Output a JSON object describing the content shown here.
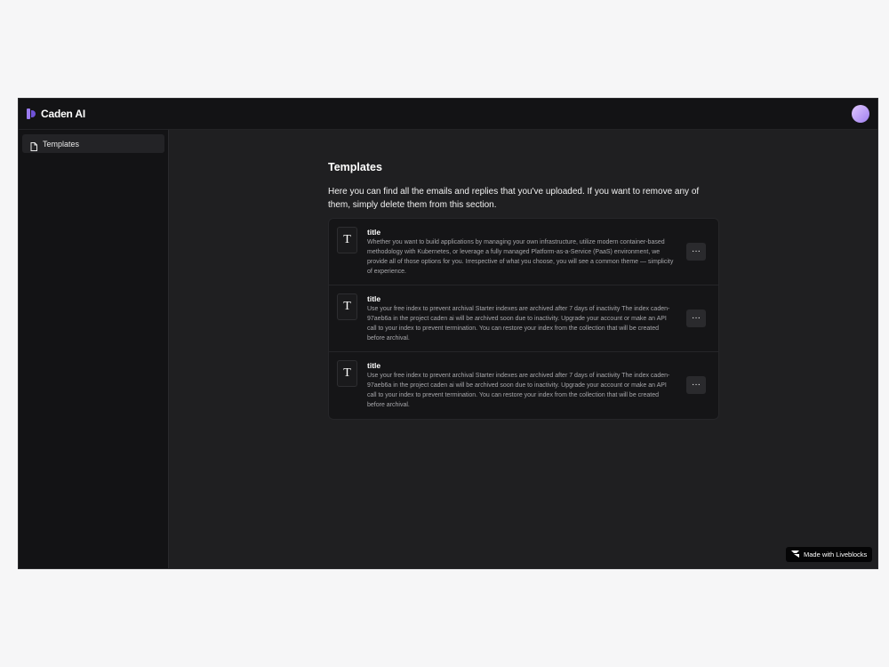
{
  "header": {
    "app_name": "Caden AI",
    "accent": "#9b7cf0"
  },
  "sidebar": {
    "items": [
      {
        "label": "Templates",
        "icon": "file-icon"
      }
    ]
  },
  "main": {
    "title": "Templates",
    "description": "Here you can find all the emails and replies that you've uploaded. If you want to remove any of them, simply delete them from this section.",
    "templates": [
      {
        "icon_letter": "T",
        "title": "title",
        "body": "Whether you want to build applications by managing your own infrastructure, utilize modern container-based methodology with Kubernetes, or leverage a fully managed Platform-as-a-Service (PaaS) environment, we provide all of those options for you. Irrespective of what you choose, you will see a common theme — simplicity of experience.",
        "menu_label": "···"
      },
      {
        "icon_letter": "T",
        "title": "title",
        "body": "Use your free index to prevent archival Starter indexes are archived after 7 days of inactivity The index caden-97aeb6a in the project caden ai will be archived soon due to inactivity. Upgrade your account or make an API call to your index to prevent termination. You can restore your index from the collection that will be created before archival.",
        "menu_label": "···"
      },
      {
        "icon_letter": "T",
        "title": "title",
        "body": "Use your free index to prevent archival Starter indexes are archived after 7 days of inactivity The index caden-97aeb6a in the project caden ai will be archived soon due to inactivity. Upgrade your account or make an API call to your index to prevent termination. You can restore your index from the collection that will be created before archival.",
        "menu_label": "···"
      }
    ]
  },
  "footer_badge": {
    "label": "Made with Liveblocks",
    "icon": "liveblocks-icon"
  }
}
